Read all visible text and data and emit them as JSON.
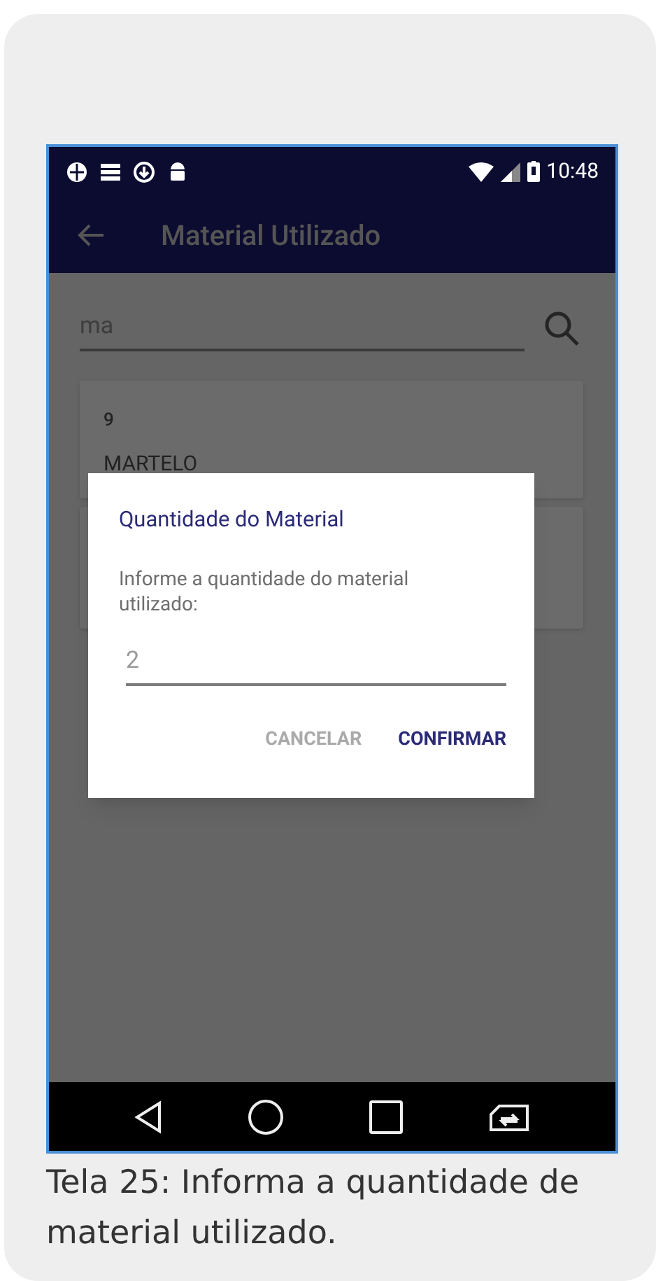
{
  "status_bar": {
    "time": "10:48"
  },
  "app_bar": {
    "title": "Material Utilizado"
  },
  "search": {
    "value": "ma"
  },
  "items": [
    {
      "code": "9",
      "name": "MARTELO"
    }
  ],
  "dialog": {
    "title": "Quantidade do Material",
    "message": "Informe a quantidade do material utilizado:",
    "field": {
      "value": "2"
    },
    "buttons": [
      {
        "label": "CANCELAR",
        "kind": "secondary"
      },
      {
        "label": "CONFIRMAR",
        "kind": "primary"
      }
    ]
  },
  "caption": "Tela 25: Informa a quantidade de material utilizado."
}
